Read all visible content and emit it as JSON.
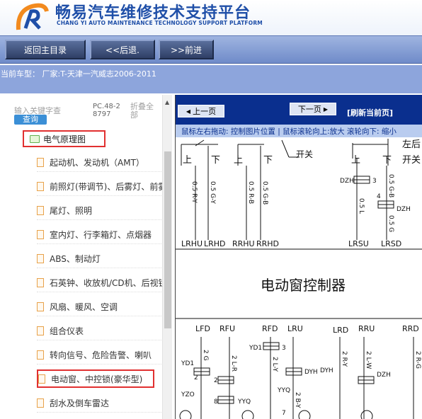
{
  "header": {
    "title_cn": "畅易汽车维修技术支持平台",
    "title_en": "CHANG YI AUTO MAINTENANCE TECHNOLOGY SUPPORT PLATFORM"
  },
  "toolbar": {
    "home_label": "返回主目录",
    "back_label": "<<后退.",
    "forward_label": ">>前进"
  },
  "vehicle_line": "当前车型： 厂家:T-天津一汽威志2006-2011",
  "search": {
    "keyword_placeholder": "输入关键字查",
    "query_label": "查询",
    "pc_code": "PC.48-28797",
    "fold_label": "折叠全部"
  },
  "tree": {
    "root_label": "电气原理图",
    "items": [
      "起动机、发动机（AMT）",
      "前照灯(带调节)、后雾灯、前雾灯",
      "尾灯、照明",
      "室内灯、行李箱灯、点烟器",
      "ABS、制动灯",
      "石英钟、收放机/CD机、后视镜",
      "风扇、暖风、空调",
      "组合仪表",
      "转向信号、危险告警、喇叭",
      "电动窗、中控锁(豪华型)",
      "刮水及倒车雷达"
    ]
  },
  "viewer": {
    "prev_label": "上一页",
    "next_label": "下一页",
    "refresh_label": "[刷新当前页]",
    "hint": "鼠标左右拖动: 控制图片位置 | 鼠标滚轮向上:放大 滚轮向下: 缩小"
  },
  "diagram": {
    "controller_label": "电动窗控制器",
    "switch_labels": [
      "上",
      "下",
      "上",
      "下",
      "开关",
      "上",
      "下",
      "左后",
      "开关"
    ],
    "top_wires": [
      "0.5 R-Y",
      "0.5 G-Y",
      "0.5 R-B",
      "0.5 G-B",
      "0.5 L",
      "0.5 G-B",
      "0.5 G"
    ],
    "top_pins": [
      "LRHU",
      "LRHD",
      "RRHU",
      "RRHD",
      "LRSU",
      "LRSD"
    ],
    "bottom_pins": [
      "LFD",
      "RFU",
      "RFD",
      "LRU",
      "LRD",
      "RRU",
      "RRD"
    ],
    "connectors": [
      "DZH",
      "3",
      "4",
      "DZH",
      "YD1",
      "YD1",
      "YZO",
      "YYQ",
      "YYQ",
      "DYH",
      "DYH",
      "DZH",
      "2",
      "8",
      "3",
      "2",
      "7"
    ],
    "bottom_wires": [
      "2 G",
      "2 L-R",
      "2 L-Y",
      "2 R-Y",
      "2 L-W",
      "2 R-G",
      "2 B-Y"
    ]
  }
}
